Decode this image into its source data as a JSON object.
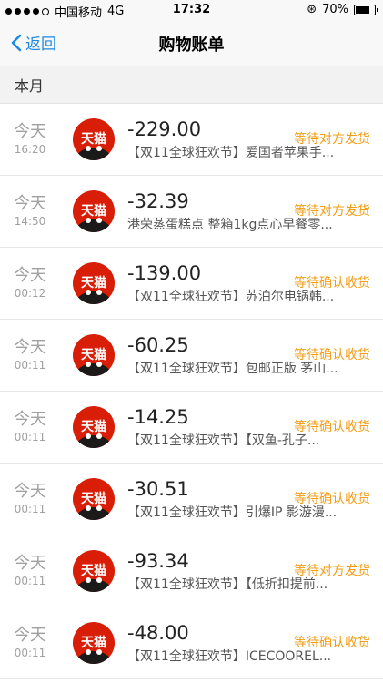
{
  "status_bar": {
    "carrier": "中国移动",
    "network": "4G",
    "time": "17:32",
    "battery": "70%"
  },
  "nav": {
    "back_label": "返回",
    "title": "购物账单"
  },
  "section": {
    "title": "本月"
  },
  "orders": [
    {
      "day": "今天",
      "time": "16:20",
      "amount": "-229.00",
      "desc": "【双11全球狂欢节】爱国者苹果手...",
      "status": "等待对方发货"
    },
    {
      "day": "今天",
      "time": "14:50",
      "amount": "-32.39",
      "desc": "港荣蒸蛋糕点 整箱1kg点心早餐零...",
      "status": "等待对方发货"
    },
    {
      "day": "今天",
      "time": "00:12",
      "amount": "-139.00",
      "desc": "【双11全球狂欢节】苏泊尔电锅韩...",
      "status": "等待确认收货"
    },
    {
      "day": "今天",
      "time": "00:11",
      "amount": "-60.25",
      "desc": "【双11全球狂欢节】包邮正版 茅山...",
      "status": "等待确认收货"
    },
    {
      "day": "今天",
      "time": "00:11",
      "amount": "-14.25",
      "desc": "【双11全球狂欢节】【双鱼-孔子...",
      "status": "等待确认收货"
    },
    {
      "day": "今天",
      "time": "00:11",
      "amount": "-30.51",
      "desc": "【双11全球狂欢节】引爆IP 影游漫...",
      "status": "等待确认收货"
    },
    {
      "day": "今天",
      "time": "00:11",
      "amount": "-93.34",
      "desc": "【双11全球狂欢节】【低折扣提前...",
      "status": "等待对方发货"
    },
    {
      "day": "今天",
      "time": "00:11",
      "amount": "-48.00",
      "desc": "【双11全球狂欢节】ICECOOREL...",
      "status": "等待确认收货"
    }
  ],
  "brand": {
    "logo_text": "天猫",
    "logo_color": "#d81e06",
    "accent": "#1e88e5",
    "status_color": "#f39c12"
  }
}
